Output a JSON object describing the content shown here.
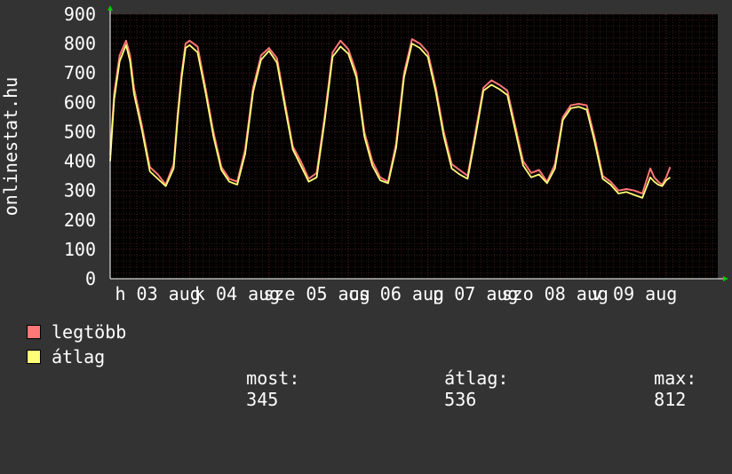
{
  "chart_data": {
    "type": "line",
    "ylabel": "onlinestat.hu",
    "ylim": [
      0,
      900
    ],
    "yticks": [
      0,
      100,
      200,
      300,
      400,
      500,
      600,
      700,
      800,
      900
    ],
    "ytick_labels": [
      "0",
      "100",
      "200",
      "300",
      "400",
      "500",
      "600",
      "700",
      "800",
      "900"
    ],
    "xlim": [
      0,
      7.65
    ],
    "day_labels": [
      {
        "x": 0.1,
        "label": "h 03 aug"
      },
      {
        "x": 1.1,
        "label": "k 04 aug"
      },
      {
        "x": 2.1,
        "label": "sze 05 aug"
      },
      {
        "x": 3.1,
        "label": "cs 06 aug"
      },
      {
        "x": 4.1,
        "label": "p 07 aug"
      },
      {
        "x": 5.1,
        "label": "szo 08 aug"
      },
      {
        "x": 6.1,
        "label": "v 09 aug"
      }
    ],
    "grid": true,
    "colors": {
      "background": "#333333",
      "plot_area": "#000000",
      "grid_minor": "#3a1a1a",
      "grid_major": "#5a2020",
      "axis_arrow": "#00cc00",
      "series_max": "#ff7777",
      "series_avg": "#ffff77"
    },
    "series": [
      {
        "name": "legtöbb",
        "color": "#ff7777",
        "x": [
          0,
          0.05,
          0.12,
          0.2,
          0.25,
          0.3,
          0.4,
          0.5,
          0.6,
          0.7,
          0.8,
          0.85,
          0.9,
          0.95,
          1.0,
          1.1,
          1.2,
          1.3,
          1.4,
          1.5,
          1.6,
          1.7,
          1.8,
          1.9,
          2.0,
          2.1,
          2.2,
          2.3,
          2.4,
          2.5,
          2.6,
          2.7,
          2.8,
          2.9,
          3.0,
          3.1,
          3.2,
          3.3,
          3.4,
          3.5,
          3.6,
          3.7,
          3.8,
          3.9,
          4.0,
          4.1,
          4.2,
          4.3,
          4.4,
          4.5,
          4.6,
          4.7,
          4.8,
          4.9,
          5.0,
          5.1,
          5.2,
          5.3,
          5.4,
          5.5,
          5.6,
          5.7,
          5.8,
          5.9,
          6.0,
          6.1,
          6.2,
          6.3,
          6.4,
          6.5,
          6.6,
          6.7,
          6.8,
          6.85,
          6.9,
          6.95,
          7.0,
          7.05
        ],
        "values": [
          420,
          630,
          760,
          810,
          760,
          650,
          520,
          380,
          355,
          320,
          390,
          560,
          700,
          800,
          810,
          790,
          650,
          500,
          380,
          340,
          330,
          440,
          650,
          760,
          785,
          750,
          600,
          450,
          400,
          340,
          360,
          550,
          770,
          810,
          780,
          700,
          500,
          400,
          345,
          330,
          460,
          700,
          815,
          800,
          770,
          650,
          500,
          390,
          370,
          350,
          500,
          650,
          675,
          660,
          640,
          520,
          400,
          360,
          370,
          330,
          390,
          550,
          590,
          595,
          590,
          480,
          350,
          330,
          300,
          305,
          300,
          290,
          375,
          345,
          330,
          320,
          345,
          380
        ]
      },
      {
        "name": "átlag",
        "color": "#ffff77",
        "x": [
          0,
          0.05,
          0.12,
          0.2,
          0.25,
          0.3,
          0.4,
          0.5,
          0.6,
          0.7,
          0.8,
          0.85,
          0.9,
          0.95,
          1.0,
          1.1,
          1.2,
          1.3,
          1.4,
          1.5,
          1.6,
          1.7,
          1.8,
          1.9,
          2.0,
          2.1,
          2.2,
          2.3,
          2.4,
          2.5,
          2.6,
          2.7,
          2.8,
          2.9,
          3.0,
          3.1,
          3.2,
          3.3,
          3.4,
          3.5,
          3.6,
          3.7,
          3.8,
          3.9,
          4.0,
          4.1,
          4.2,
          4.3,
          4.4,
          4.5,
          4.6,
          4.7,
          4.8,
          4.9,
          5.0,
          5.1,
          5.2,
          5.3,
          5.4,
          5.5,
          5.6,
          5.7,
          5.8,
          5.9,
          6.0,
          6.1,
          6.2,
          6.3,
          6.4,
          6.5,
          6.6,
          6.7,
          6.8,
          6.85,
          6.9,
          6.95,
          7.0,
          7.05
        ],
        "values": [
          400,
          610,
          740,
          795,
          740,
          630,
          505,
          365,
          340,
          315,
          375,
          545,
          685,
          785,
          795,
          770,
          635,
          485,
          370,
          330,
          320,
          425,
          635,
          745,
          775,
          735,
          585,
          440,
          385,
          330,
          345,
          535,
          755,
          790,
          765,
          685,
          485,
          385,
          335,
          325,
          445,
          685,
          800,
          785,
          755,
          635,
          485,
          375,
          355,
          340,
          485,
          640,
          660,
          645,
          625,
          505,
          385,
          345,
          355,
          325,
          375,
          540,
          580,
          585,
          575,
          465,
          340,
          320,
          290,
          295,
          285,
          275,
          345,
          330,
          320,
          315,
          335,
          345
        ]
      }
    ],
    "stats": {
      "current_label": "most:",
      "current_value": 345,
      "average_label": "átlag:",
      "average_value": 536,
      "max_label": "max:",
      "max_value": 812
    }
  }
}
